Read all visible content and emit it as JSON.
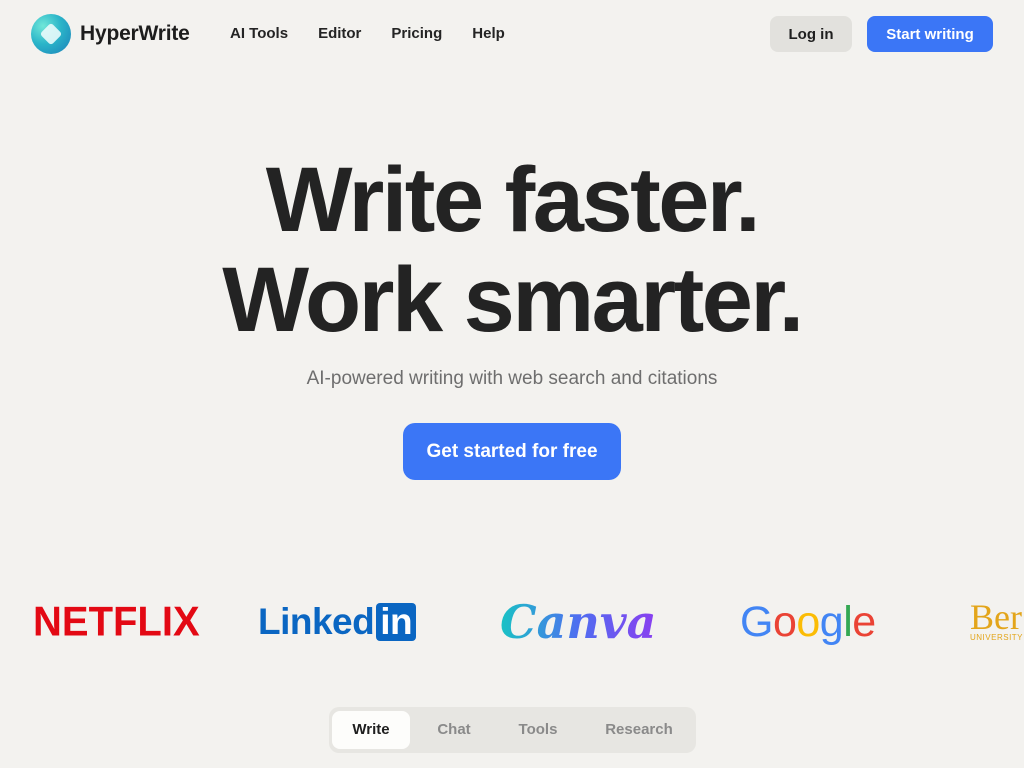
{
  "header": {
    "brand_name": "HyperWrite",
    "nav": [
      {
        "label": "AI Tools"
      },
      {
        "label": "Editor"
      },
      {
        "label": "Pricing"
      },
      {
        "label": "Help"
      }
    ],
    "login_label": "Log in",
    "start_label": "Start writing"
  },
  "hero": {
    "line1": "Write faster.",
    "line2": "Work smarter.",
    "subtitle": "AI-powered writing with web search and citations",
    "cta_label": "Get started for free"
  },
  "logos": {
    "netflix": "NETFLIX",
    "linkedin_text": "Linked",
    "linkedin_box": "in",
    "canva": "Canva",
    "google": [
      "G",
      "o",
      "o",
      "g",
      "l",
      "e"
    ],
    "google_colors": [
      "#4285f4",
      "#ea4335",
      "#fbbc05",
      "#4285f4",
      "#34a853",
      "#ea4335"
    ],
    "berkeley_word": "Ber",
    "berkeley_sub": "UNIVERSITY"
  },
  "tabs": [
    {
      "label": "Write",
      "active": true
    },
    {
      "label": "Chat",
      "active": false
    },
    {
      "label": "Tools",
      "active": false
    },
    {
      "label": "Research",
      "active": false
    }
  ],
  "colors": {
    "accent": "#3b76f6",
    "background": "#f3f2ef"
  }
}
